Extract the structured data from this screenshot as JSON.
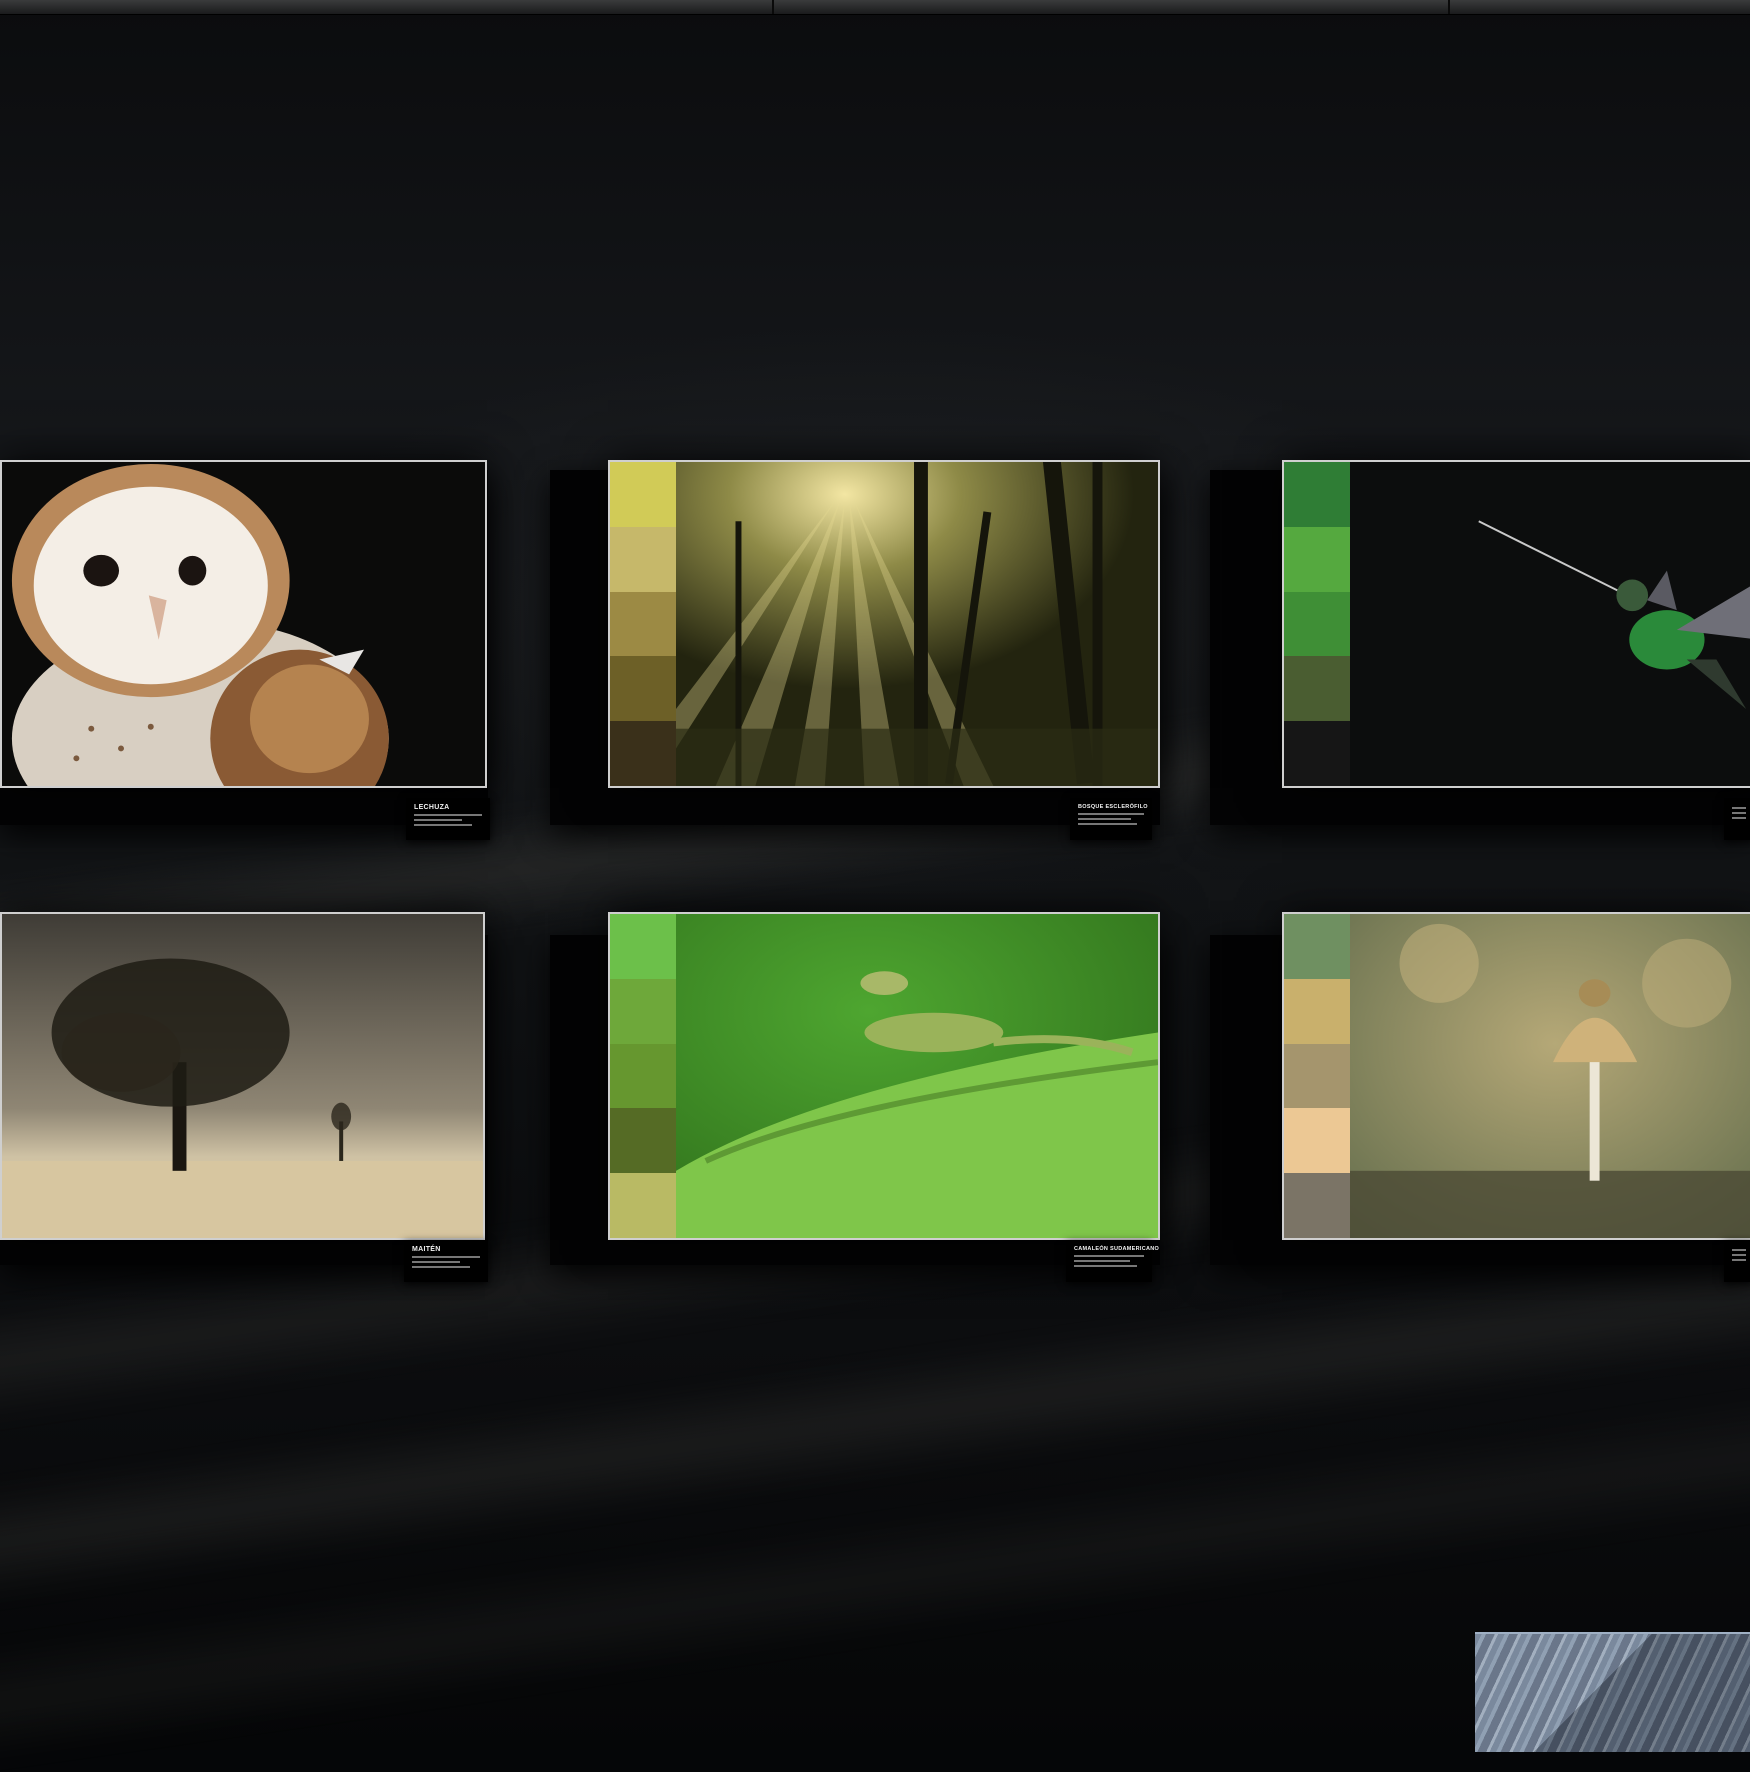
{
  "scene": "gallery wall",
  "colors": {
    "wall": "#0f1113",
    "frame": "#cfcfcf"
  },
  "artworks": [
    {
      "id": "lechuza",
      "title": "LECHUZA",
      "subject": "barn-owl",
      "swatches": []
    },
    {
      "id": "bosque",
      "title": "BOSQUE ESCLERÓFILO",
      "subject": "forest-sunrays",
      "swatches": [
        "#d1cb57",
        "#c6b86a",
        "#9c8a44",
        "#6d6027",
        "#3a301a"
      ]
    },
    {
      "id": "colibri",
      "title": "",
      "subject": "hummingbird",
      "swatches": [
        "#2f7d35",
        "#55a93f",
        "#3f8f36",
        "#4a5d31",
        "#161616"
      ]
    },
    {
      "id": "maiten",
      "title": "MAITÉN",
      "subject": "tree-landscape",
      "swatches": []
    },
    {
      "id": "camaleon",
      "title": "CAMALEÓN SUDAMERICANO",
      "subject": "lizard",
      "swatches": [
        "#6cc04a",
        "#6ea83a",
        "#66972f",
        "#556b25",
        "#b9ba64"
      ]
    },
    {
      "id": "hongo",
      "title": "",
      "subject": "mushroom",
      "swatches": [
        "#6f9061",
        "#c9b06c",
        "#a5956d",
        "#ecc894",
        "#7b7466"
      ]
    }
  ]
}
